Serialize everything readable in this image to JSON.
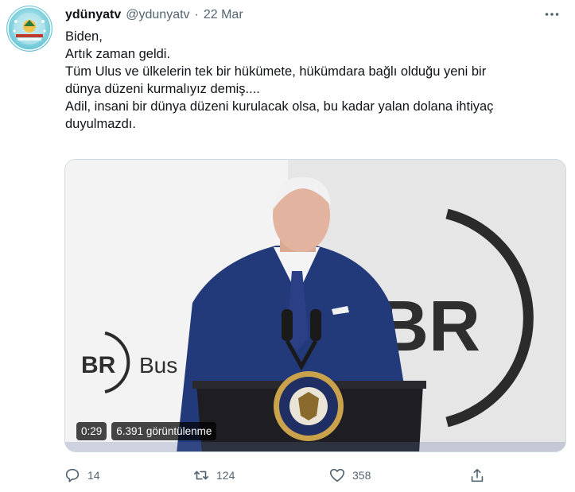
{
  "tweet": {
    "display_name": "ydünyatv",
    "handle": "@ydunyatv",
    "separator": "·",
    "date": "22 Mar",
    "text_lines": [
      "Biden,",
      "Artık zaman geldi.",
      "Tüm Ulus ve ülkelerin tek bir hükümete, hükümdara bağlı olduğu yeni bir",
      "dünya düzeni kurmalıyız demiş....",
      "Adil, insani bir dünya düzeni kurulacak olsa, bu kadar yalan dolana ihtiyaç",
      "duyulmazdı."
    ]
  },
  "media": {
    "duration": "0:29",
    "views": "6.391 görüntülenme",
    "backdrop_logo_large": "BR",
    "backdrop_logo_small": "BR",
    "backdrop_text_partial": "Bus"
  },
  "actions": {
    "reply_count": "14",
    "retweet_count": "124",
    "like_count": "358"
  },
  "colors": {
    "text_primary": "#0f1419",
    "text_secondary": "#536471",
    "suit": "#233a7a",
    "podium": "#1e1e22"
  },
  "icons": [
    "more-icon",
    "reply-icon",
    "retweet-icon",
    "like-icon",
    "share-icon"
  ]
}
